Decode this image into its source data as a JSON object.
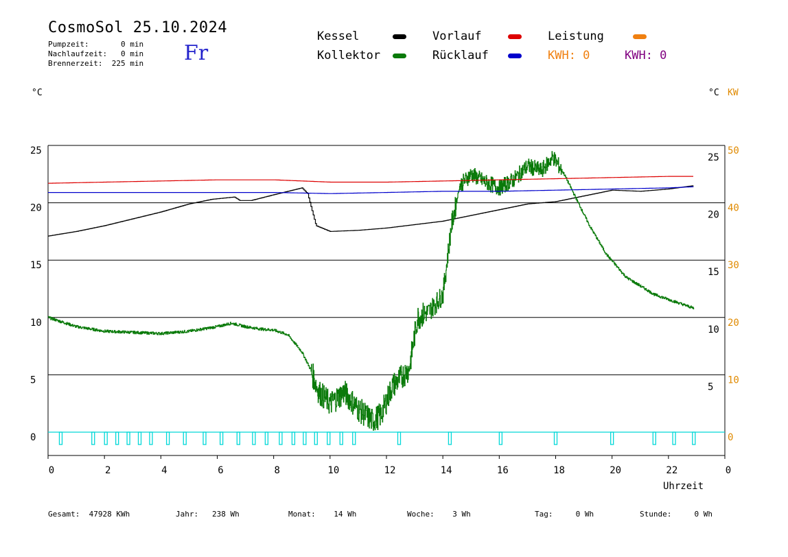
{
  "header": {
    "title": "CosmoSol 25.10.2024",
    "day": "Fr",
    "pumpzeit": "Pumpzeit:       0 min",
    "nachlaufzeit": "Nachlaufzeit:   0 min",
    "brennerzeit": "Brennerzeit:  225 min"
  },
  "legend": {
    "kessel": "Kessel",
    "kollektor": "Kollektor",
    "vorlauf": "Vorlauf",
    "ruecklauf": "Rücklauf",
    "leistung": "Leistung",
    "kwh_orange": "KWH: 0",
    "kwh_purple": "KWH: 0"
  },
  "axes": {
    "left_unit": "°C",
    "right_unit_c": "°C",
    "right_unit_kw": "KW",
    "x_label": "Uhrzeit"
  },
  "footer": {
    "gesamt": "Gesamt:  47928 KWh",
    "jahr": "Jahr:   238 Wh",
    "monat": "Monat:    14 Wh",
    "woche": "Woche:    3 Wh",
    "tag": "Tag:     0 Wh",
    "stunde": "Stunde:     0 Wh"
  },
  "colors": {
    "kessel": "#000000",
    "kollektor": "#0a7a0a",
    "vorlauf": "#dd0000",
    "ruecklauf": "#0000cc",
    "leistung": "#f08010",
    "kwh_purple": "#800080",
    "pump": "#00d8d8",
    "right_kw_ticks": "#e08a00"
  },
  "chart_data": {
    "type": "line",
    "title": "CosmoSol 25.10.2024",
    "xlabel": "Uhrzeit",
    "ylabel": "°C",
    "xlim": [
      0,
      24
    ],
    "ylim": [
      0,
      25
    ],
    "y2lim": [
      0,
      50
    ],
    "x_ticks": [
      "0",
      "2",
      "4",
      "6",
      "8",
      "10",
      "12",
      "14",
      "16",
      "18",
      "20",
      "22",
      "0"
    ],
    "y_ticks_left": [
      "0",
      "5",
      "10",
      "15",
      "20",
      "25"
    ],
    "y_ticks_right_c": [
      "5",
      "10",
      "15",
      "20",
      "25"
    ],
    "y_ticks_right_kw": [
      "0",
      "10",
      "20",
      "30",
      "40",
      "50"
    ],
    "grid": true,
    "series": [
      {
        "name": "Kessel",
        "x": [
          0,
          1,
          2,
          3,
          4,
          5,
          5.8,
          6.6,
          6.8,
          7.2,
          8,
          9,
          9.2,
          9.5,
          10,
          11,
          12,
          13,
          14,
          15,
          16,
          17,
          18,
          19,
          20,
          21,
          22,
          22.9
        ],
        "values": [
          17.1,
          17.5,
          18.0,
          18.6,
          19.2,
          19.9,
          20.3,
          20.5,
          20.2,
          20.2,
          20.7,
          21.3,
          20.8,
          18.0,
          17.5,
          17.6,
          17.8,
          18.1,
          18.4,
          18.9,
          19.4,
          19.9,
          20.1,
          20.6,
          21.1,
          21.0,
          21.2,
          21.5
        ]
      },
      {
        "name": "Kollektor",
        "x": [
          0,
          0.5,
          1,
          1.5,
          2,
          3,
          4,
          5,
          6,
          6.5,
          7,
          7.5,
          8,
          8.5,
          9,
          9.3,
          9.6,
          10,
          10.5,
          11,
          11.5,
          11.8,
          12.2,
          12.8,
          13.1,
          13.5,
          14,
          14.3,
          14.6,
          15,
          15.5,
          16,
          16.5,
          17,
          17.5,
          17.9,
          18.3,
          18.7,
          19.2,
          19.8,
          20.5,
          21.5,
          22.2,
          22.9
        ],
        "values": [
          10.0,
          9.6,
          9.2,
          9.0,
          8.8,
          8.7,
          8.6,
          8.8,
          9.2,
          9.5,
          9.2,
          9.0,
          8.9,
          8.5,
          7.0,
          5.5,
          3.5,
          2.5,
          3.5,
          2.0,
          1.0,
          1.5,
          4.0,
          5.5,
          10.0,
          10.5,
          12.0,
          18.0,
          21.5,
          22.5,
          21.8,
          21.3,
          22.0,
          23.2,
          22.8,
          24.0,
          22.5,
          20.5,
          18.0,
          15.5,
          13.5,
          12.0,
          11.4,
          10.8
        ]
      },
      {
        "name": "Vorlauf",
        "x": [
          0,
          2,
          4,
          6,
          8,
          9,
          10,
          12,
          14,
          16,
          18,
          20,
          22,
          22.9
        ],
        "values": [
          21.7,
          21.8,
          21.9,
          22.0,
          22.0,
          21.9,
          21.8,
          21.8,
          21.9,
          22.0,
          22.1,
          22.2,
          22.3,
          22.3
        ]
      },
      {
        "name": "Rücklauf",
        "x": [
          0,
          2,
          4,
          6,
          8,
          10,
          12,
          14,
          16,
          18,
          20,
          22,
          22.9
        ],
        "values": [
          20.9,
          20.9,
          20.9,
          20.9,
          20.9,
          20.8,
          20.9,
          21.0,
          21.0,
          21.1,
          21.2,
          21.3,
          21.4
        ]
      },
      {
        "name": "Leistung",
        "x": [
          0,
          24
        ],
        "values": [
          0,
          0
        ]
      }
    ],
    "pump_pulses_h": [
      0.45,
      1.6,
      2.05,
      2.45,
      2.85,
      3.25,
      3.65,
      4.25,
      4.85,
      5.55,
      6.15,
      6.75,
      7.3,
      7.75,
      8.25,
      8.7,
      9.1,
      9.5,
      9.95,
      10.4,
      10.85,
      12.45,
      14.25,
      16.05,
      18.0,
      20.0,
      21.5,
      22.2,
      22.9
    ]
  }
}
